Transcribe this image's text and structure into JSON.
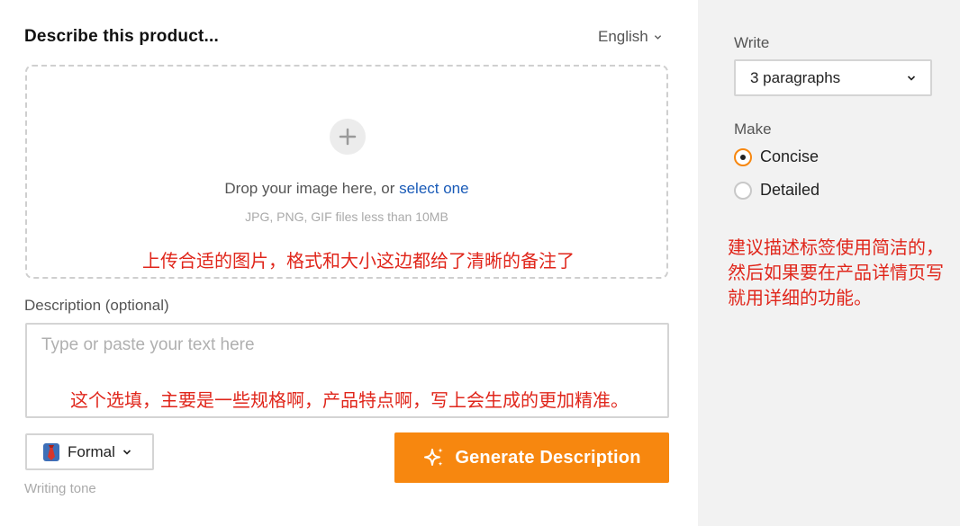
{
  "header": {
    "title": "Describe this product...",
    "language": "English"
  },
  "upload": {
    "drop_text": "Drop your image here, or ",
    "select_link": "select one",
    "hint": "JPG, PNG, GIF files less than 10MB",
    "annotation": "上传合适的图片，格式和大小这边都给了清晰的备注了"
  },
  "description": {
    "label": "Description (optional)",
    "placeholder": "Type or paste your text here",
    "value": "",
    "annotation": "这个选填，主要是一些规格啊，产品特点啊，写上会生成的更加精准。"
  },
  "tone": {
    "value": "Formal",
    "icon": "necktie-icon",
    "label": "Writing tone"
  },
  "generate": {
    "label": "Generate Description",
    "icon": "sparkle-icon",
    "color": "#f7870f"
  },
  "sidebar": {
    "write_label": "Write",
    "write_value": "3 paragraphs",
    "make_label": "Make",
    "options": [
      {
        "label": "Concise",
        "selected": true
      },
      {
        "label": "Detailed",
        "selected": false
      }
    ],
    "annotation": "建议描述标签使用简洁的，然后如果要在产品详情页写就用详细的功能。"
  },
  "colors": {
    "accent": "#f7870f",
    "link": "#1a5bb8",
    "annotation": "#e0261b",
    "sidebar_bg": "#f2f2f2"
  }
}
